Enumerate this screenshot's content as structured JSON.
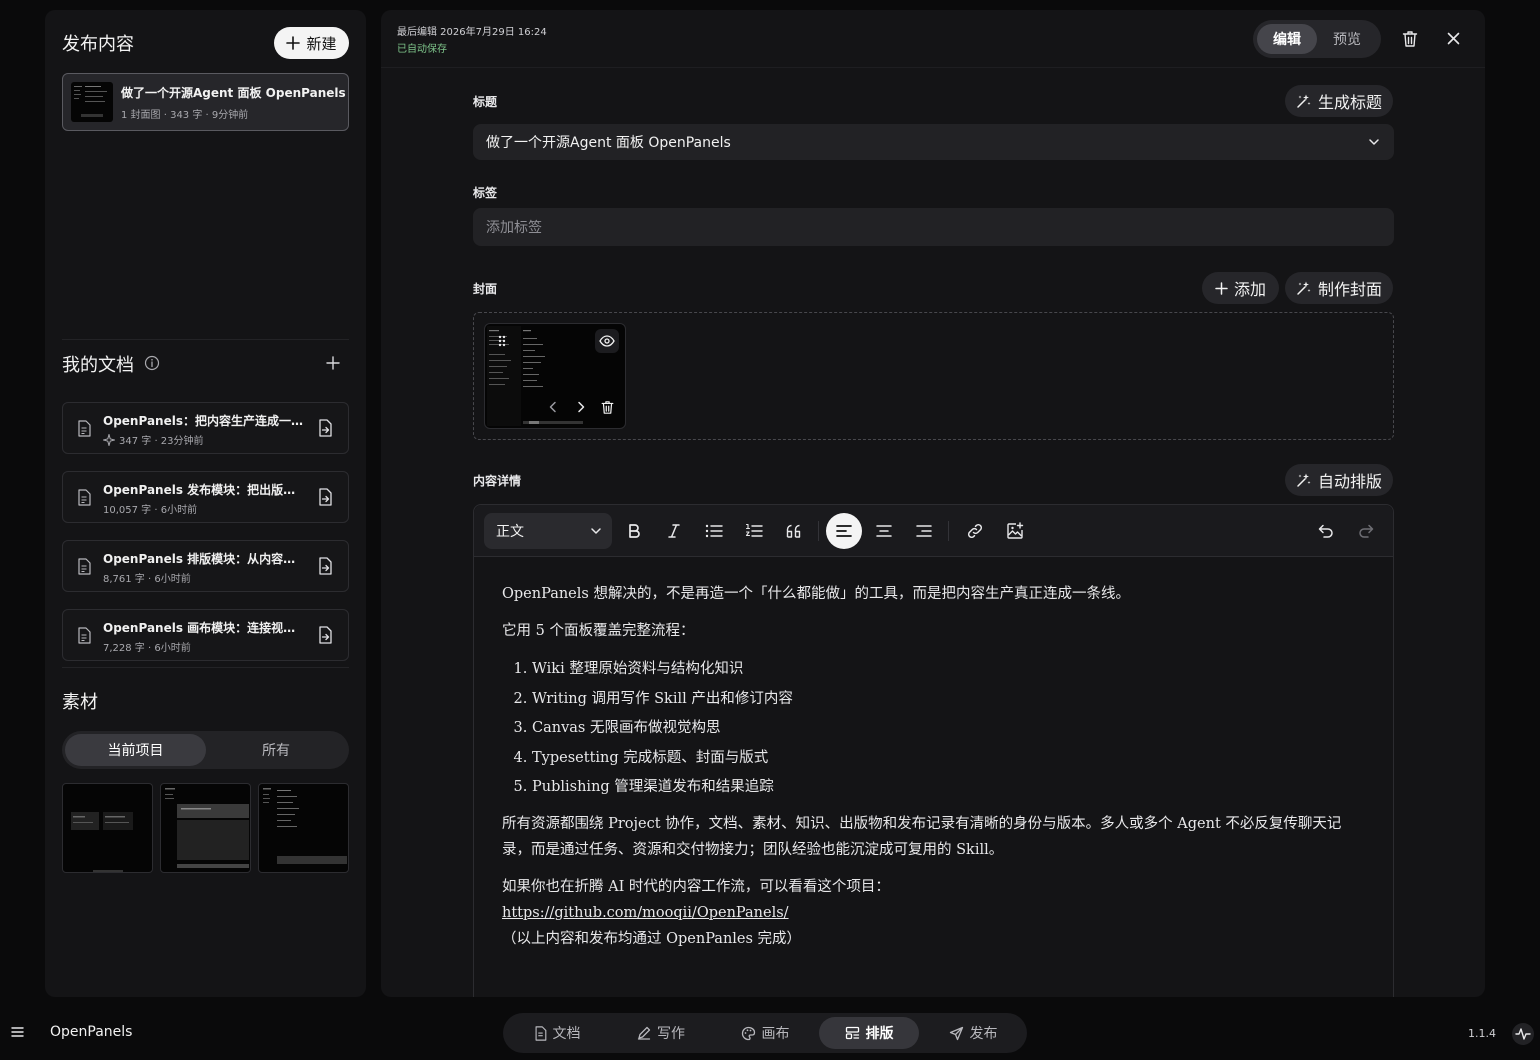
{
  "left_panel": {
    "publish": {
      "title": "发布内容",
      "new_label": "新建",
      "card": {
        "name": "做了一个开源Agent 面板 OpenPanels",
        "meta": "1 封面图 · 343 字 · 9分钟前"
      }
    },
    "docs": {
      "title": "我的文档",
      "items": [
        {
          "name": "OpenPanels：把内容生产连成一条线",
          "meta": "347 字 · 23分钟前"
        },
        {
          "name": "OpenPanels 发布模块：把出版物发布出去",
          "meta": "10,057 字 · 6小时前"
        },
        {
          "name": "OpenPanels 排版模块：从内容文档到出版物",
          "meta": "8,761 字 · 6小时前"
        },
        {
          "name": "OpenPanels 画布模块：连接视觉与内容",
          "meta": "7,228 字 · 6小时前"
        }
      ]
    },
    "materials": {
      "title": "素材",
      "tab_current": "当前项目",
      "tab_all": "所有"
    }
  },
  "main": {
    "meta_edited": "最后编辑 2026年7月29日 16:24",
    "meta_saved": "已自动保存",
    "mode_edit": "编辑",
    "mode_preview": "预览",
    "title_label": "标题",
    "gen_title": "生成标题",
    "title_value": "做了一个开源Agent 面板 OpenPanels",
    "tags_label": "标签",
    "tags_placeholder": "添加标签",
    "cover_label": "封面",
    "cover_add": "添加",
    "cover_make": "制作封面",
    "content_label": "内容详情",
    "auto_layout": "自动排版",
    "style_select": "正文",
    "content": {
      "p1": "OpenPanels 想解决的，不是再造一个「什么都能做」的工具，而是把内容生产真正连成一条线。",
      "p2": "它用 5 个面板覆盖完整流程：",
      "list": [
        "Wiki 整理原始资料与结构化知识",
        "Writing 调用写作 Skill 产出和修订内容",
        "Canvas 无限画布做视觉构思",
        "Typesetting 完成标题、封面与版式",
        "Publishing 管理渠道发布和结果追踪"
      ],
      "p3": "所有资源都围绕 Project 协作，文档、素材、知识、出版物和发布记录有清晰的身份与版本。多人或多个 Agent 不必反复传聊天记录，而是通过任务、资源和交付物接力；团队经验也能沉淀成可复用的 Skill。",
      "p4": "如果你也在折腾 AI 时代的内容工作流，可以看看这个项目：",
      "link": "https://github.com/mooqii/OpenPanels/",
      "p5": "（以上内容和发布均通过 OpenPanles 完成）"
    }
  },
  "bottom": {
    "brand": "OpenPanels",
    "nav": [
      "文档",
      "写作",
      "画布",
      "排版",
      "发布"
    ],
    "active": "排版",
    "version": "1.1.4"
  },
  "colors": {
    "saved": "#7ec48a",
    "panel": "#141416",
    "background": "#0a0a0b"
  }
}
